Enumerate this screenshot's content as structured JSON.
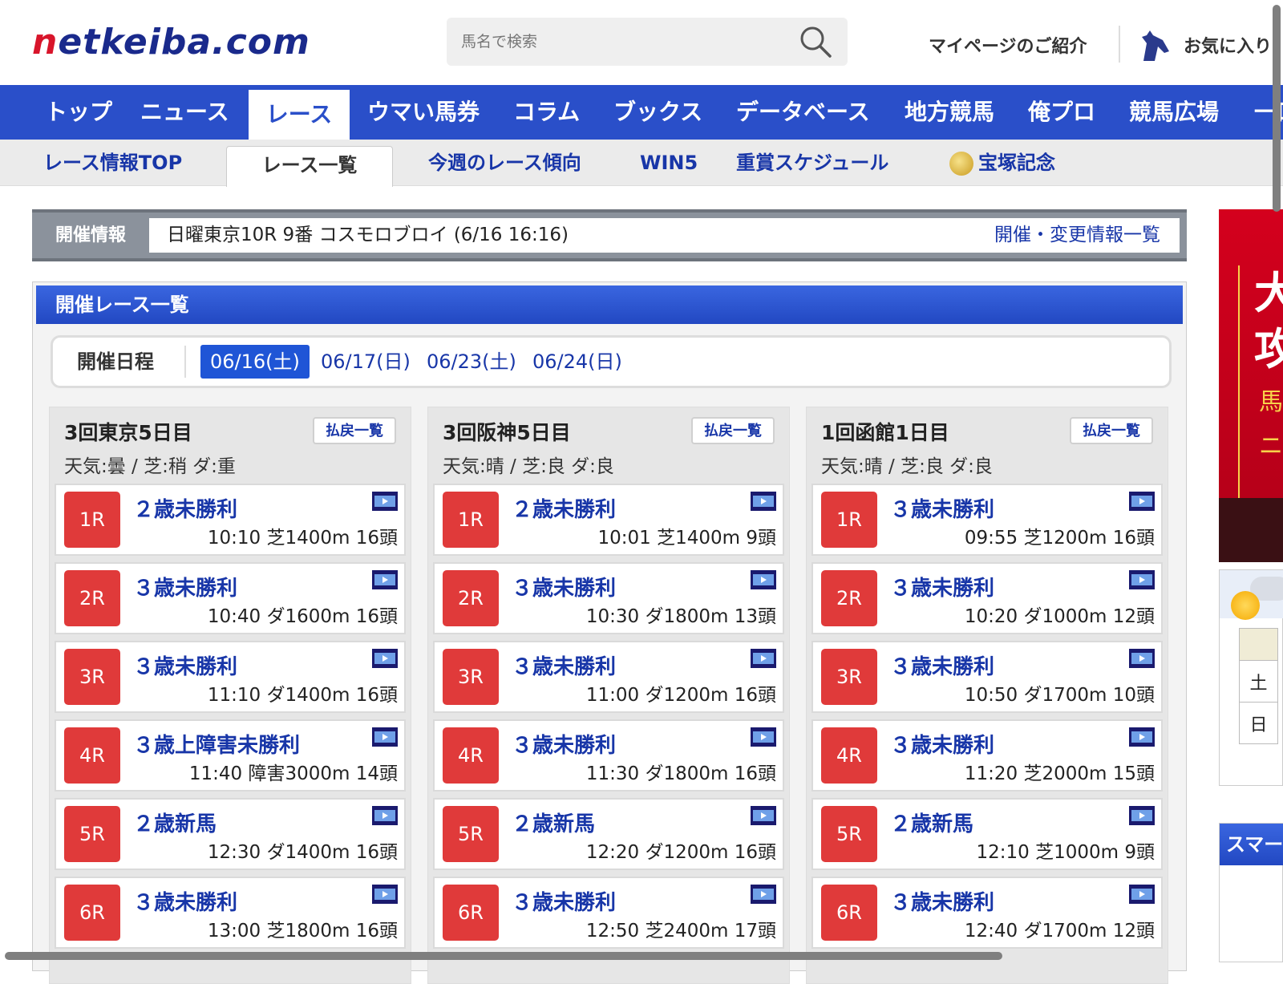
{
  "header": {
    "logo_prefix": "n",
    "logo_rest": "etkeiba.com",
    "search_placeholder": "馬名で検索",
    "mypage_label": "マイページのご紹介",
    "favorite_label": "お気に入り"
  },
  "global_nav": {
    "items": [
      {
        "label": "トップ"
      },
      {
        "label": "ニュース"
      },
      {
        "label": "レース"
      },
      {
        "label": "ウマい馬券"
      },
      {
        "label": "コラム"
      },
      {
        "label": "ブックス"
      },
      {
        "label": "データベース"
      },
      {
        "label": "地方競馬"
      },
      {
        "label": "俺プロ"
      },
      {
        "label": "競馬広場"
      },
      {
        "label": "一口"
      }
    ],
    "active_index": 2
  },
  "sub_nav": {
    "items": [
      {
        "label": "レース情報TOP"
      },
      {
        "label": "レース一覧"
      },
      {
        "label": "今週のレース傾向"
      },
      {
        "label": "WIN5"
      },
      {
        "label": "重賞スケジュール"
      },
      {
        "label": "宝塚記念"
      }
    ],
    "active_index": 1
  },
  "info_bar": {
    "label": "開催情報",
    "text": "日曜東京10R 9番 コスモロブロイ (6/16 16:16)",
    "link": "開催・変更情報一覧"
  },
  "race_list": {
    "title": "開催レース一覧",
    "schedule_label": "開催日程",
    "dates": [
      "06/16(土)",
      "06/17(日)",
      "06/23(土)",
      "06/24(日)"
    ],
    "active_date_index": 0,
    "payout_label": "払戻一覧",
    "venues": [
      {
        "name": "3回東京5日目",
        "weather": "天気:曇 / 芝:稍  ダ:重",
        "races": [
          {
            "num": "1R",
            "name": "２歳未勝利",
            "meta": "10:10 芝1400m 16頭"
          },
          {
            "num": "2R",
            "name": "３歳未勝利",
            "meta": "10:40 ダ1600m 16頭"
          },
          {
            "num": "3R",
            "name": "３歳未勝利",
            "meta": "11:10 ダ1400m 16頭"
          },
          {
            "num": "4R",
            "name": "３歳上障害未勝利",
            "meta": "11:40 障害3000m 14頭"
          },
          {
            "num": "5R",
            "name": "２歳新馬",
            "meta": "12:30 ダ1400m 16頭"
          },
          {
            "num": "6R",
            "name": "３歳未勝利",
            "meta": "13:00 芝1800m 16頭"
          }
        ]
      },
      {
        "name": "3回阪神5日目",
        "weather": "天気:晴 / 芝:良  ダ:良",
        "races": [
          {
            "num": "1R",
            "name": "２歳未勝利",
            "meta": "10:01 芝1400m 9頭"
          },
          {
            "num": "2R",
            "name": "３歳未勝利",
            "meta": "10:30 ダ1800m 13頭"
          },
          {
            "num": "3R",
            "name": "３歳未勝利",
            "meta": "11:00 ダ1200m 16頭"
          },
          {
            "num": "4R",
            "name": "３歳未勝利",
            "meta": "11:30 ダ1800m 16頭"
          },
          {
            "num": "5R",
            "name": "２歳新馬",
            "meta": "12:20 ダ1200m 16頭"
          },
          {
            "num": "6R",
            "name": "３歳未勝利",
            "meta": "12:50 芝2400m 17頭"
          }
        ]
      },
      {
        "name": "1回函館1日目",
        "weather": "天気:晴 / 芝:良  ダ:良",
        "races": [
          {
            "num": "1R",
            "name": "３歳未勝利",
            "meta": "09:55 芝1200m 16頭"
          },
          {
            "num": "2R",
            "name": "３歳未勝利",
            "meta": "10:20 ダ1000m 12頭"
          },
          {
            "num": "3R",
            "name": "３歳未勝利",
            "meta": "10:50 ダ1700m 10頭"
          },
          {
            "num": "4R",
            "name": "３歳未勝利",
            "meta": "11:20 芝2000m 15頭"
          },
          {
            "num": "5R",
            "name": "２歳新馬",
            "meta": "12:10 芝1000m 9頭"
          },
          {
            "num": "6R",
            "name": "３歳未勝利",
            "meta": "12:40 ダ1700m 12頭"
          }
        ]
      }
    ]
  },
  "sidebar": {
    "ad_chars": [
      "大",
      "攻",
      "馬",
      "ニ"
    ],
    "weather_days": [
      "土",
      "日"
    ],
    "smart_title": "スマー"
  },
  "colors": {
    "brand_blue": "#2a4fc9",
    "link_blue": "#1836a8",
    "race_red": "#e03a3a",
    "logo_red": "#d8152b"
  },
  "icons": [
    "search-icon",
    "horse-icon",
    "video-icon",
    "medal-icon",
    "weather-icon"
  ]
}
